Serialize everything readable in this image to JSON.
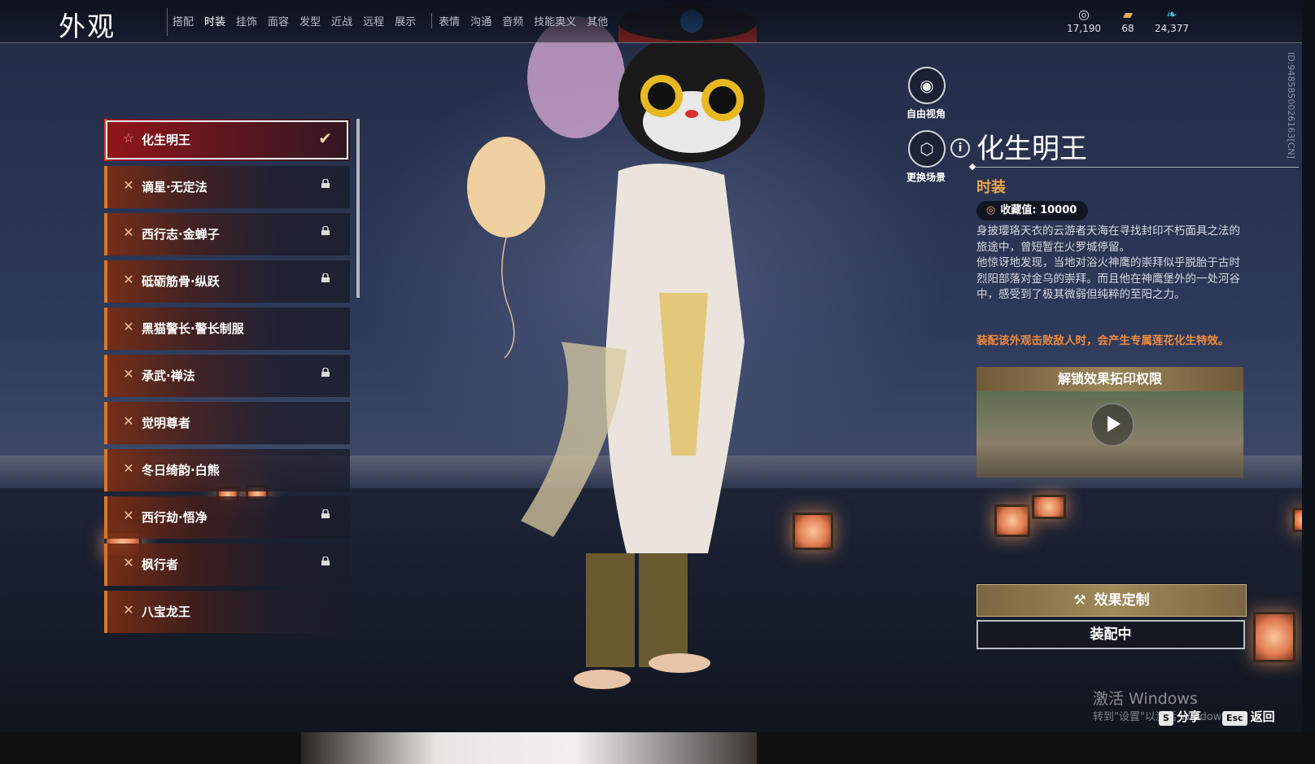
{
  "app": {
    "title": "外观"
  },
  "tabs": [
    {
      "label": "搭配",
      "active": false
    },
    {
      "label": "时装",
      "active": true
    },
    {
      "label": "挂饰",
      "active": false
    },
    {
      "label": "面容",
      "active": false
    },
    {
      "label": "发型",
      "active": false
    },
    {
      "label": "近战",
      "active": false
    },
    {
      "label": "远程",
      "active": false
    },
    {
      "label": "展示",
      "active": false
    },
    {
      "label": "表情",
      "active": false
    },
    {
      "label": "沟通",
      "active": false
    },
    {
      "label": "音频",
      "active": false
    },
    {
      "label": "技能奥义",
      "active": false
    },
    {
      "label": "其他",
      "active": false
    }
  ],
  "currencies": [
    {
      "icon": "coin-icon",
      "value": "17,190"
    },
    {
      "icon": "ticket-icon",
      "value": "68"
    },
    {
      "icon": "feather-icon",
      "value": "24,377"
    }
  ],
  "outfit_list": [
    {
      "label": "化生明王",
      "selected": true,
      "locked": false,
      "equipped": true
    },
    {
      "label": "谪星·无定法",
      "selected": false,
      "locked": true,
      "equipped": false
    },
    {
      "label": "西行志·金蝉子",
      "selected": false,
      "locked": true,
      "equipped": false
    },
    {
      "label": "砥砺筋骨·纵跃",
      "selected": false,
      "locked": true,
      "equipped": false
    },
    {
      "label": "黑猫警长·警长制服",
      "selected": false,
      "locked": false,
      "equipped": false
    },
    {
      "label": "承武·禅法",
      "selected": false,
      "locked": true,
      "equipped": false
    },
    {
      "label": "觉明尊者",
      "selected": false,
      "locked": false,
      "equipped": false
    },
    {
      "label": "冬日绮韵·白熊",
      "selected": false,
      "locked": false,
      "equipped": false
    },
    {
      "label": "西行劫·悟净",
      "selected": false,
      "locked": true,
      "equipped": false
    },
    {
      "label": "枫行者",
      "selected": false,
      "locked": true,
      "equipped": false
    },
    {
      "label": "八宝龙王",
      "selected": false,
      "locked": false,
      "equipped": false
    }
  ],
  "view_controls": {
    "free_view_label": "自由视角",
    "change_scene_label": "更换场景"
  },
  "details": {
    "name": "化生明王",
    "category": "时装",
    "collection_label": "收藏值: 10000",
    "description": "身披璎珞天衣的云游者天海在寻找封印不朽面具之法的旅途中，曾短暂在火罗城停留。\n他惊讶地发现，当地对浴火神鹰的崇拜似乎脱胎于古时烈阳部落对金乌的崇拜。而且他在神鹰堡外的一处河谷中，感受到了极其微弱但纯粹的至阳之力。",
    "effect_note": "装配该外观击败敌人时，会产生专属莲花化生特效。",
    "unlock_header": "解锁效果拓印权限",
    "customize_label": "效果定制",
    "equip_label": "装配中"
  },
  "footer": {
    "activate_title": "激活 Windows",
    "activate_sub": "转到\"设置\"以激活 Windows",
    "share_key": "S",
    "share_label": "分享",
    "back_key": "Esc",
    "back_label": "返回"
  },
  "player_id": "ID:9485850026163[CN]",
  "colors": {
    "accent_red": "#e83020",
    "accent_orange": "#d37a2a",
    "gold": "#e8a650",
    "effect_note": "#ef8a40"
  }
}
